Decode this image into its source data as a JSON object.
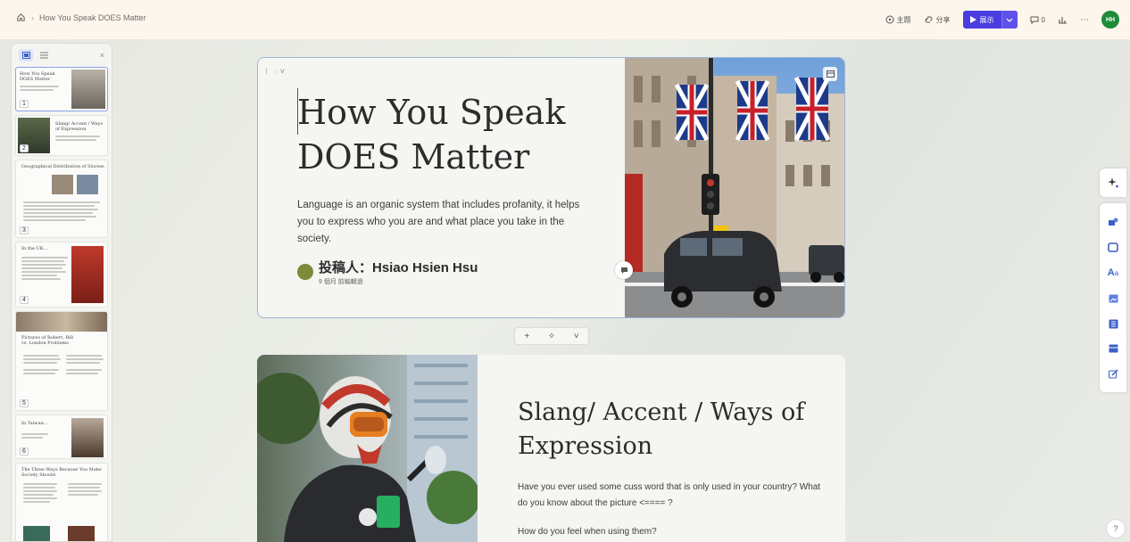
{
  "topbar": {
    "breadcrumb_title": "How You Speak DOES Matter",
    "theme_label": "主題",
    "share_label": "分享",
    "present_label": "展示",
    "comments_count": "0",
    "avatar_initials": "HH"
  },
  "thumbnails": [
    {
      "num": "1",
      "title": "How You Speak DOES Matter"
    },
    {
      "num": "2",
      "title": "Slang/ Accent / Ways of Expression"
    },
    {
      "num": "3",
      "title": "Geographical Distribution of Slurses"
    },
    {
      "num": "4",
      "title": "In the UK..."
    },
    {
      "num": "5",
      "title": "Pictures of Robert, Bill vs. London Problems"
    },
    {
      "num": "6",
      "title": "In Taiwan..."
    },
    {
      "num": "",
      "title": "The Three Ways Because You Make Society Should"
    }
  ],
  "card1": {
    "title": "How You Speak DOES Matter",
    "description": "Language is an organic system that includes profanity, it helps you to express who you are and what place you take in the society.",
    "author_name": "投稿人：Hsiao Hsien Hsu",
    "author_sub": "9 個月 前編輯過"
  },
  "card2": {
    "title": "Slang/ Accent / Ways of Expression",
    "p1": "Have you ever used some cuss word that is only used in your country?  What do you know about the picture <==== ?",
    "p2": "How do you feel when using them?"
  },
  "help_label": "?",
  "colors": {
    "accent": "#4b3ee0",
    "avatar": "#1e8b3a",
    "card_border": "#9fb4d9"
  }
}
